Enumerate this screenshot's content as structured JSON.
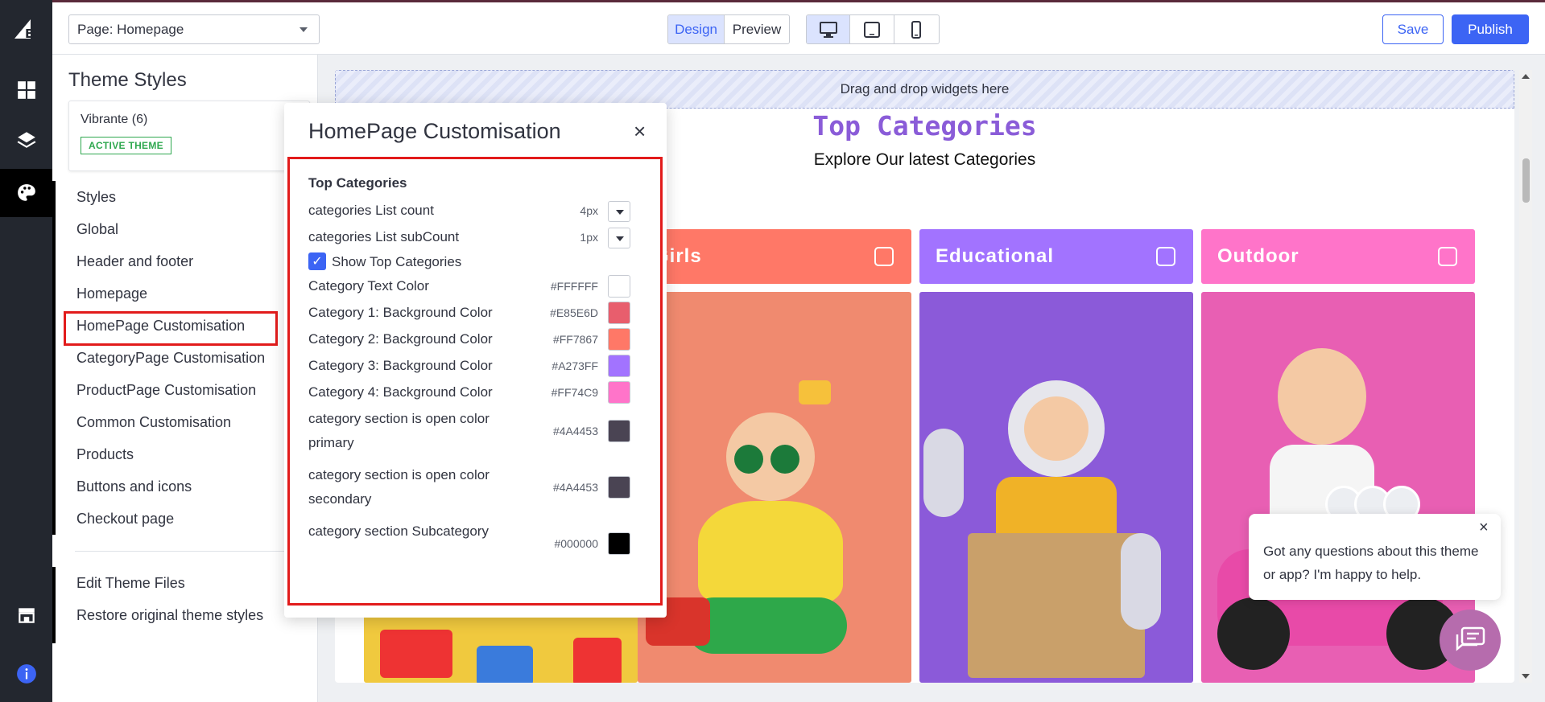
{
  "topbar": {
    "page_select": "Page: Homepage",
    "view_modes": [
      "Design",
      "Preview"
    ],
    "save_label": "Save",
    "publish_label": "Publish"
  },
  "sidebar": {
    "title": "Theme Styles",
    "theme_name": "Vibrante (6)",
    "theme_badge": "ACTIVE THEME",
    "items": [
      {
        "label": "Styles"
      },
      {
        "label": "Global"
      },
      {
        "label": "Header and footer"
      },
      {
        "label": "Homepage"
      },
      {
        "label": "HomePage Customisation"
      },
      {
        "label": "CategoryPage Customisation"
      },
      {
        "label": "ProductPage Customisation"
      },
      {
        "label": "Common Customisation"
      },
      {
        "label": "Products"
      },
      {
        "label": "Buttons and icons"
      },
      {
        "label": "Checkout page"
      }
    ],
    "footer_items": [
      {
        "label": "Edit Theme Files"
      },
      {
        "label": "Restore original theme styles"
      }
    ]
  },
  "canvas": {
    "dropzone": "Drag and drop widgets here",
    "section_title": "Top Categories",
    "section_subtitle": "Explore Our latest Categories",
    "categories": [
      {
        "label": "Girls",
        "color": "#FF7867"
      },
      {
        "label": "Educational",
        "color": "#A273FF"
      },
      {
        "label": "Outdoor",
        "color": "#FF74C9"
      }
    ]
  },
  "modal": {
    "title": "HomePage Customisation",
    "close": "×",
    "section": "Top Categories",
    "list_count": {
      "label": "categories List count",
      "value": "4px"
    },
    "list_subcount": {
      "label": "categories List subCount",
      "value": "1px"
    },
    "show_top": {
      "label": "Show Top Categories",
      "checked": true
    },
    "colors": [
      {
        "label": "Category Text Color",
        "hex": "#FFFFFF"
      },
      {
        "label": "Category 1: Background Color",
        "hex": "#E85E6D"
      },
      {
        "label": "Category 2: Background Color",
        "hex": "#FF7867"
      },
      {
        "label": "Category 3: Background Color",
        "hex": "#A273FF"
      },
      {
        "label": "Category 4: Background Color",
        "hex": "#FF74C9"
      },
      {
        "label": "category section is open color primary",
        "hex": "#4A4453"
      },
      {
        "label": "category section is open color secondary",
        "hex": "#4A4453"
      },
      {
        "label": "category section Subcategory",
        "hex": "#000000"
      }
    ]
  },
  "chat": {
    "message": "Got any questions about this theme or app? I'm happy to help.",
    "close": "×"
  }
}
